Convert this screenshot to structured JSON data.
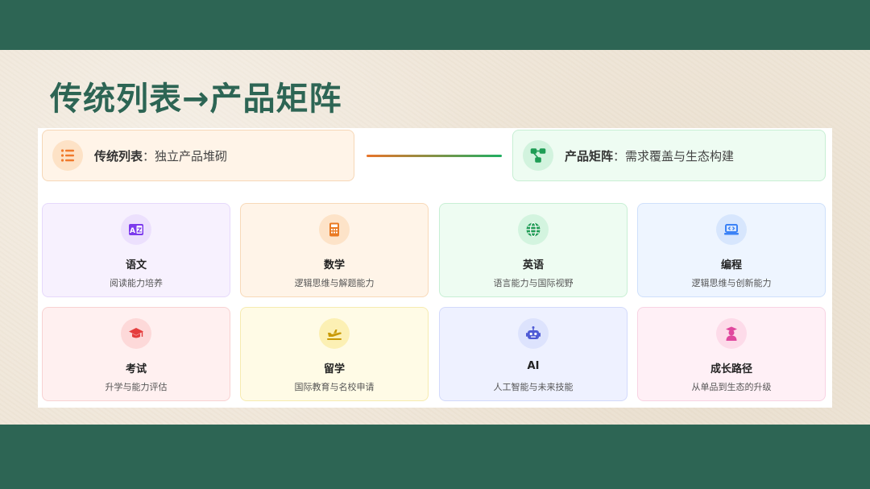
{
  "slide": {
    "title": "传统列表→产品矩阵"
  },
  "comparison": {
    "left": {
      "label": "传统列表",
      "separator": "：",
      "desc": "独立产品堆砌",
      "icon": "list-icon",
      "accent": "#f07a2c"
    },
    "right": {
      "label": "产品矩阵",
      "separator": "：",
      "desc": "需求覆盖与生态构建",
      "icon": "network-icon",
      "accent": "#1f9d55"
    }
  },
  "cards": [
    {
      "name": "语文",
      "desc": "阅读能力培养",
      "icon": "translate-icon",
      "bg": "#f7f1fe",
      "border": "#e6d9fb",
      "iconBg": "#ece0fd",
      "iconColor": "#7c3aed"
    },
    {
      "name": "数学",
      "desc": "逻辑思维与解题能力",
      "icon": "calculator-icon",
      "bg": "#fff4e8",
      "border": "#f8d9b8",
      "iconBg": "#fde3c8",
      "iconColor": "#ea7a22"
    },
    {
      "name": "英语",
      "desc": "语言能力与国际视野",
      "icon": "globe-icon",
      "bg": "#eefcf2",
      "border": "#c8efd4",
      "iconBg": "#d3f4df",
      "iconColor": "#1f9d55"
    },
    {
      "name": "编程",
      "desc": "逻辑思维与创新能力",
      "icon": "laptop-code-icon",
      "bg": "#eef5ff",
      "border": "#cfe0fb",
      "iconBg": "#d7e6fd",
      "iconColor": "#3b82f6"
    },
    {
      "name": "考试",
      "desc": "升学与能力评估",
      "icon": "graduation-cap-icon",
      "bg": "#fff0f0",
      "border": "#f8d2d2",
      "iconBg": "#fdd9d9",
      "iconColor": "#e53e3e"
    },
    {
      "name": "留学",
      "desc": "国际教育与名校申请",
      "icon": "airplane-icon",
      "bg": "#fffbe6",
      "border": "#f6ebb0",
      "iconBg": "#fcf0b4",
      "iconColor": "#c99a06"
    },
    {
      "name": "AI",
      "desc": "人工智能与未来技能",
      "icon": "robot-icon",
      "bg": "#eef1ff",
      "border": "#d3dafb",
      "iconBg": "#dde3fd",
      "iconColor": "#4f5bd5"
    },
    {
      "name": "成长路径",
      "desc": "从单品到生态的升级",
      "icon": "student-icon",
      "bg": "#fff0f6",
      "border": "#f8d3e3",
      "iconBg": "#fddbe9",
      "iconColor": "#e0479e"
    }
  ]
}
